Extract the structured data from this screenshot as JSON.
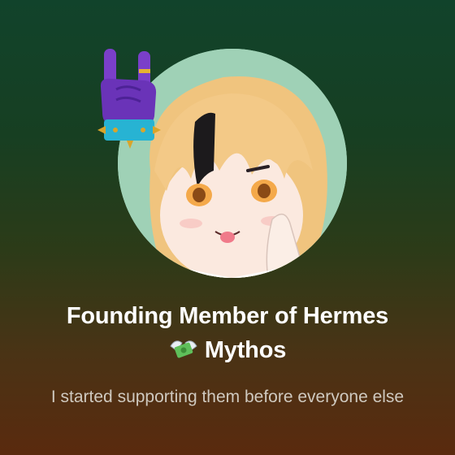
{
  "badge": {
    "title_line1": "Founding Member of Hermes",
    "title_line2": "Mythos",
    "description": "I started supporting them before everyone else",
    "icons": [
      "rock-hand-icon",
      "money-with-wings-icon"
    ],
    "colors": {
      "avatar_bg": "#9fd1b6",
      "title": "#ffffff",
      "description": "#cfc9bf"
    }
  }
}
